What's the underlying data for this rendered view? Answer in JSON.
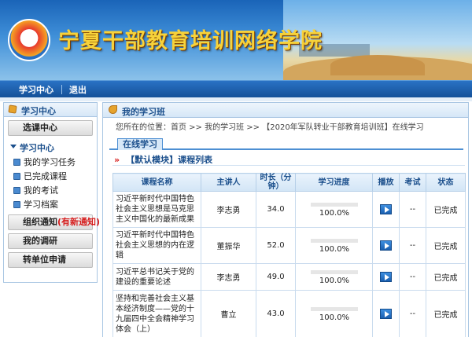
{
  "header": {
    "site_title": "宁夏干部教育培训网络学院"
  },
  "nav": {
    "items": [
      "学习中心",
      "退出"
    ]
  },
  "sidebar": {
    "title": "学习中心",
    "select_center": "选课中心",
    "section_title": "学习中心",
    "links": [
      "我的学习任务",
      "已完成课程",
      "我的考试",
      "学习档案"
    ],
    "notice_label": "组织通知",
    "notice_badge": "(有新通知)",
    "my_class": "我的调研",
    "transfer": "转单位申请"
  },
  "main": {
    "title": "我的学习班",
    "breadcrumb": "您所在的位置：首页 >> 我的学习班 >> 【2020年军队转业干部教育培训班】在线学习",
    "tab": "在线学习",
    "module_mark": "»",
    "module_title": "【默认模块】课程列表",
    "columns": {
      "name": "课程名称",
      "lecturer": "主讲人",
      "duration": "时长（分钟）",
      "progress": "学习进度",
      "play": "播放",
      "exam": "考试",
      "status": "状态"
    },
    "rows": [
      {
        "name": "习近平新时代中国特色社会主义思想是马克思主义中国化的最新成果",
        "lecturer": "李志勇",
        "duration": "34.0",
        "progress": 1.0,
        "progress_text": "100.0%",
        "exam": "--",
        "status": "已完成"
      },
      {
        "name": "习近平新时代中国特色社会主义思想的内在逻辑",
        "lecturer": "董振华",
        "duration": "52.0",
        "progress": 1.0,
        "progress_text": "100.0%",
        "exam": "--",
        "status": "已完成"
      },
      {
        "name": "习近平总书记关于党的建设的重要论述",
        "lecturer": "李志勇",
        "duration": "49.0",
        "progress": 1.0,
        "progress_text": "100.0%",
        "exam": "--",
        "status": "已完成"
      },
      {
        "name": "坚持和完善社会主义基本经济制度——党的十九届四中全会精神学习体会（上）",
        "lecturer": "曹立",
        "duration": "43.0",
        "progress": 1.0,
        "progress_text": "100.0%",
        "exam": "--",
        "status": "已完成"
      }
    ]
  }
}
